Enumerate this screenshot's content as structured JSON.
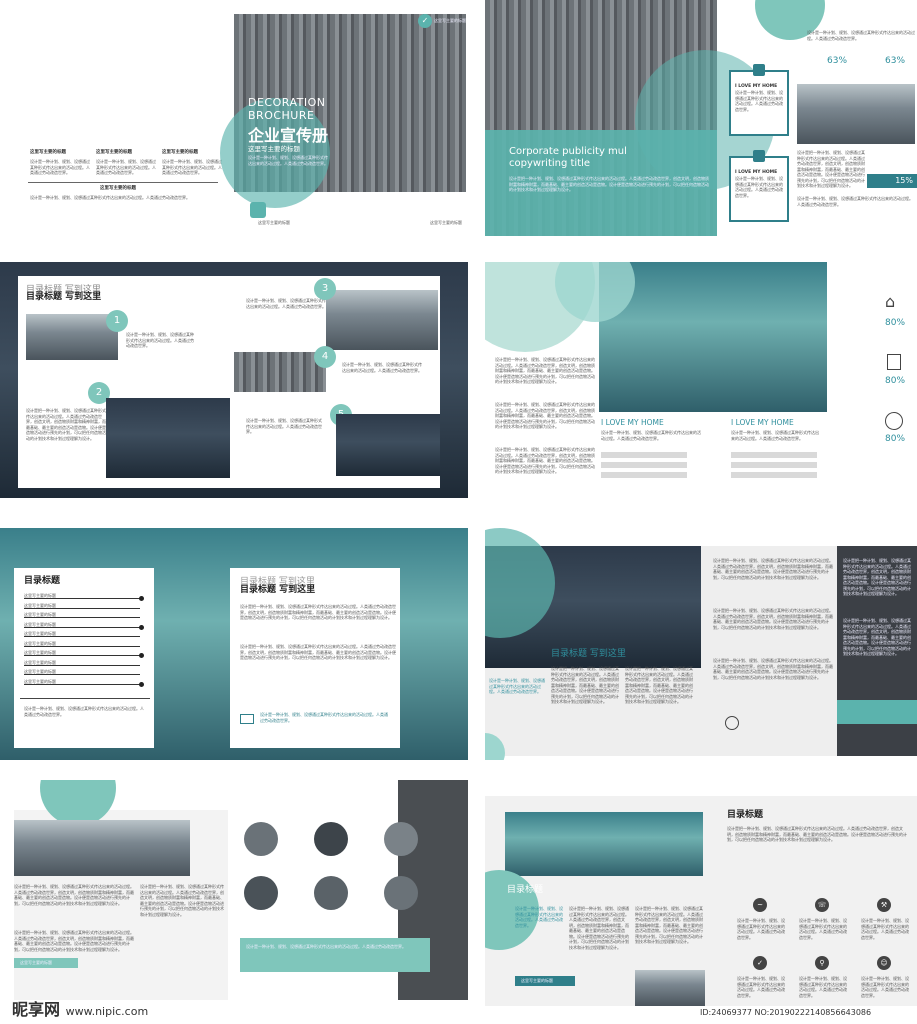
{
  "common": {
    "placeholder_title": "这里写主要的标题",
    "body_text": "设计是把一种计划、规划、设想通过某种形式传达出来的活动过程。人类通过劳动改造世界，创造文明，创造物质财富和精神财富，而最基础、最主要的创造活动是造物。设计便是造物活动进行预先的计划，可以把任何造物活动的计划技术和计划过程理解为设计。",
    "body_short": "设计是一种计划、规划、设想通过某种形式传达出来的活动过程。人类通过劳动改造世界。"
  },
  "spread1": {
    "title_en_1": "DECORATION",
    "title_en_2": "BROCHURE",
    "title_cn": "企业宣传册",
    "subtitle": "这里写主要的标题",
    "check_caption": "这里写主要的标题",
    "left_labels": [
      "这里写主要的标题",
      "这里写主要的标题",
      "这里写主要的标题"
    ],
    "mid_label": "这里写主要的标题",
    "footer_left": "这里写主要的标题",
    "footer_right": "这里写主要的标题"
  },
  "spread2": {
    "heading_1": "Corporate publicity mul",
    "heading_2": "copywriting title",
    "card_title": "I LOVE MY HOME",
    "pct_1": "63%",
    "pct_2": "63%",
    "pct_3": "15%"
  },
  "spread3": {
    "title": "目录标题  写到这里",
    "numbers": [
      "1",
      "2",
      "3",
      "4",
      "5"
    ]
  },
  "spread4": {
    "home_1": "I LOVE MY HOME",
    "home_2": "I LOVE MY HOME",
    "pct": [
      "80%",
      "80%",
      "80%"
    ]
  },
  "spread5": {
    "toc_title": "目录标题",
    "right_title_1": "目录标题  写到这里",
    "right_title_2": "目录标题  写到这里"
  },
  "spread6": {
    "title": "目录标题  写到这里"
  },
  "spread7": {
    "label": "这里写主要的标题"
  },
  "spread8": {
    "title": "目录标题",
    "photo_title": "目录标题",
    "button": "这里写主要的标题"
  },
  "watermark": {
    "logo": "昵享网",
    "url": "www.nipic.com",
    "id": "ID:24069377 NO:20190222140856643086"
  }
}
